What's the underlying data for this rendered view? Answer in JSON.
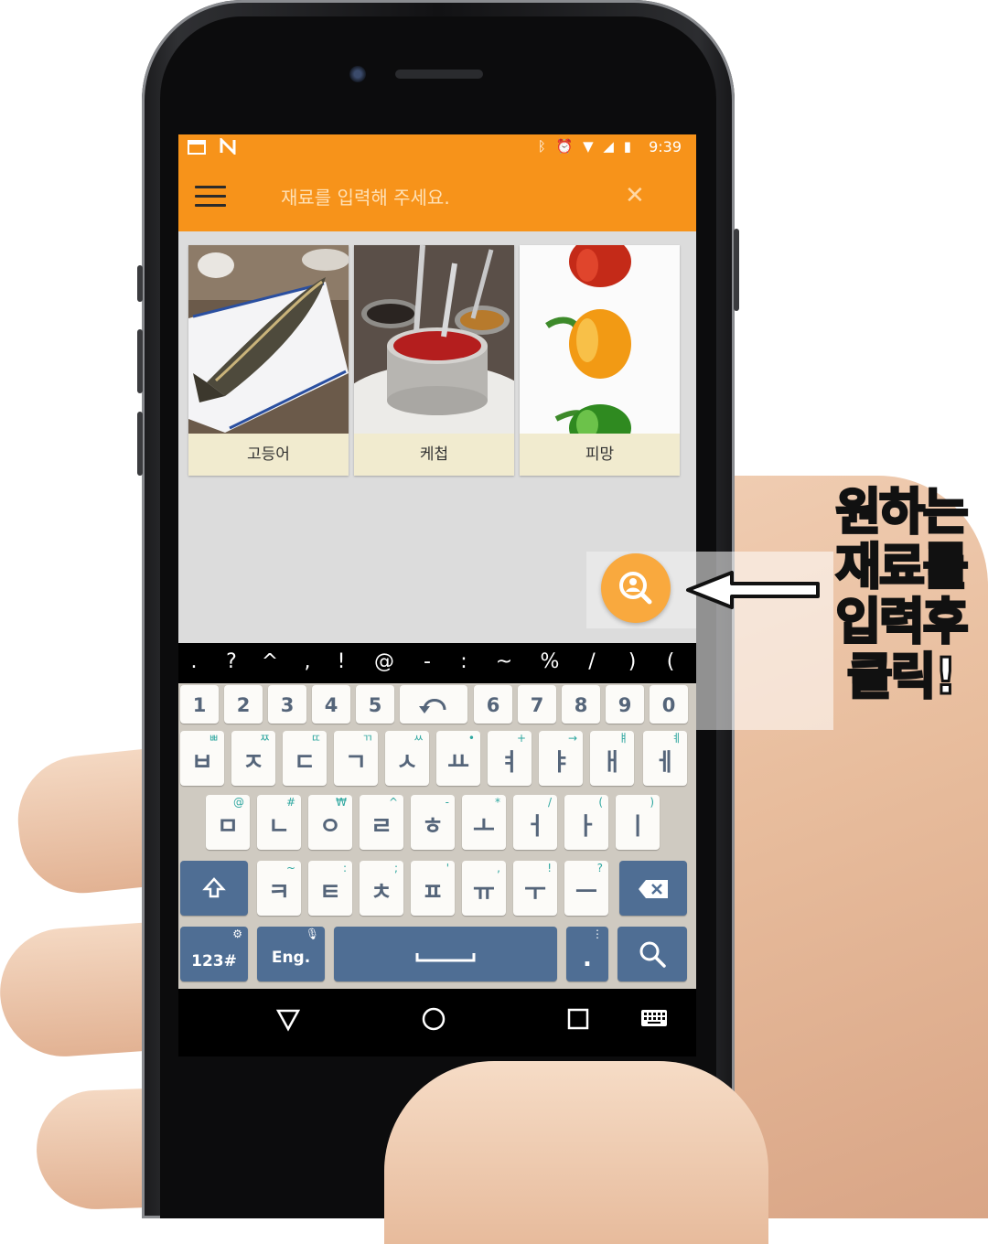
{
  "status_bar": {
    "left_icons": [
      "calendar-icon",
      "n-icon"
    ],
    "right_icons": [
      "bluetooth-icon",
      "alarm-icon",
      "wifi-icon",
      "signal-icon",
      "battery-icon"
    ],
    "time": "9:39"
  },
  "toolbar": {
    "menu_icon": "menu-icon",
    "search_placeholder": "재료를 입력해 주세요.",
    "search_value": "",
    "close_icon": "close-icon"
  },
  "ingredients": [
    {
      "label": "고등어",
      "image": "grilled-mackerel-photo"
    },
    {
      "label": "케첩",
      "image": "ketchup-sauce-cups-photo"
    },
    {
      "label": "피망",
      "image": "bell-peppers-photo"
    }
  ],
  "fab": {
    "icon": "search-person-icon"
  },
  "keyboard": {
    "symbols": [
      ".",
      "?",
      "^",
      ",",
      "!",
      "@",
      "-",
      ":",
      "~",
      "%",
      "/",
      ")",
      "("
    ],
    "numbers": [
      "1",
      "2",
      "3",
      "4",
      "5",
      "6",
      "7",
      "8",
      "9",
      "0"
    ],
    "undo_icon": "undo-icon",
    "row1": [
      {
        "key": "ㅂ",
        "hint": "ㅃ"
      },
      {
        "key": "ㅈ",
        "hint": "ㅉ"
      },
      {
        "key": "ㄷ",
        "hint": "ㄸ"
      },
      {
        "key": "ㄱ",
        "hint": "ㄲ"
      },
      {
        "key": "ㅅ",
        "hint": "ㅆ"
      },
      {
        "key": "ㅛ",
        "hint": "•"
      },
      {
        "key": "ㅕ",
        "hint": "+"
      },
      {
        "key": "ㅑ",
        "hint": "→"
      },
      {
        "key": "ㅐ",
        "hint": "ㅒ"
      },
      {
        "key": "ㅔ",
        "hint": "ㅖ"
      }
    ],
    "row2": [
      {
        "key": "ㅁ",
        "hint": "@"
      },
      {
        "key": "ㄴ",
        "hint": "#"
      },
      {
        "key": "ㅇ",
        "hint": "₩"
      },
      {
        "key": "ㄹ",
        "hint": "^"
      },
      {
        "key": "ㅎ",
        "hint": "-"
      },
      {
        "key": "ㅗ",
        "hint": "*"
      },
      {
        "key": "ㅓ",
        "hint": "/"
      },
      {
        "key": "ㅏ",
        "hint": "("
      },
      {
        "key": "ㅣ",
        "hint": ")"
      }
    ],
    "row3": [
      {
        "key": "ㅋ",
        "hint": "~"
      },
      {
        "key": "ㅌ",
        "hint": ":"
      },
      {
        "key": "ㅊ",
        "hint": ";"
      },
      {
        "key": "ㅍ",
        "hint": "'"
      },
      {
        "key": "ㅠ",
        "hint": ","
      },
      {
        "key": "ㅜ",
        "hint": "!"
      },
      {
        "key": "ㅡ",
        "hint": "?"
      }
    ],
    "shift_icon": "shift-icon",
    "backspace_icon": "backspace-icon",
    "num_mode_label": "123#",
    "settings_icon": "gear-icon",
    "lang_label": "Eng.",
    "mic_icon": "mic-icon",
    "space_icon": "space-icon",
    "period_label": ".",
    "period_hint": "⋮",
    "search_key_icon": "search-icon"
  },
  "nav_bar": {
    "icons": [
      "back-triangle-icon",
      "home-circle-icon",
      "recents-square-icon",
      "keyboard-icon"
    ]
  },
  "annotation": {
    "lines": [
      "원하는",
      "재료를",
      "입력후",
      "클릭!"
    ],
    "arrow_icon": "left-arrow-icon"
  },
  "colors": {
    "accent": "#f7931a",
    "fab": "#f9a93e",
    "card_label_bg": "#f1ebcf",
    "keyboard_function_key": "#4f6e94",
    "keyboard_bg": "#cfcac1"
  }
}
